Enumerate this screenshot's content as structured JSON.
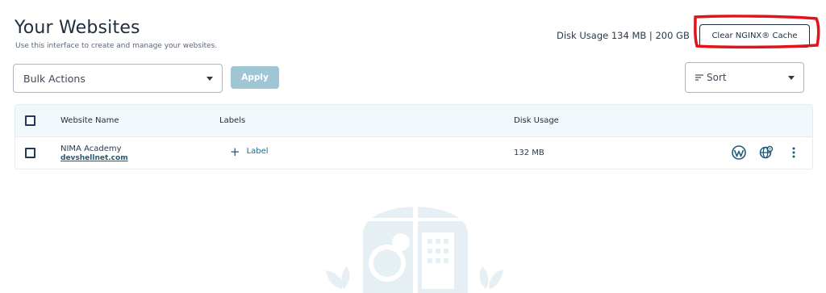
{
  "header": {
    "title": "Your Websites",
    "subtitle": "Use this interface to create and manage your websites.",
    "disk_usage": "Disk Usage  134 MB  |  200 GB",
    "clear_cache_label": "Clear NGINX® Cache"
  },
  "toolbar": {
    "bulk_actions_label": "Bulk Actions",
    "apply_label": "Apply",
    "sort_label": "Sort"
  },
  "table": {
    "columns": [
      "Website Name",
      "Labels",
      "Disk Usage"
    ],
    "rows": [
      {
        "name": "NIMA Academy",
        "domain": "devshellnet.com",
        "label_action": "Label",
        "disk_usage": "132 MB"
      }
    ]
  },
  "icons": {
    "wordpress": "wordpress-icon",
    "dns": "globe-settings-icon",
    "more": "more-vertical-icon"
  },
  "colors": {
    "accent": "#1e5a7a",
    "apply_button": "#9fc6d4",
    "header_bg": "#f0f8fb",
    "highlight": "#e3131b"
  }
}
